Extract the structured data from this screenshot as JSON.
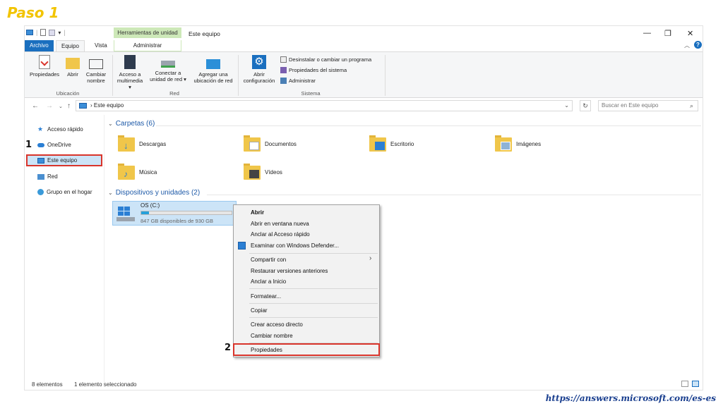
{
  "overlay": {
    "step_title": "Paso 1",
    "marker_1": "1",
    "marker_2": "2",
    "source_url": "https://answers.microsoft.com/es-es"
  },
  "window": {
    "context_tab_group": "Herramientas de unidad",
    "title": "Este equipo",
    "tabs": [
      "Archivo",
      "Equipo",
      "Vista",
      "Administrar"
    ],
    "active_tab": "Equipo",
    "accent_color": "#1a6fbf"
  },
  "ribbon": {
    "groups": [
      {
        "label": "Ubicación",
        "buttons": [
          {
            "label": "Propiedades",
            "icon": "properties-icon"
          },
          {
            "label": "Abrir",
            "icon": "open-folder-icon"
          },
          {
            "label_line1": "Cambiar",
            "label_line2": "nombre",
            "icon": "rename-icon"
          }
        ]
      },
      {
        "label": "Red",
        "buttons": [
          {
            "label_line1": "Acceso a",
            "label_line2": "multimedia ▾",
            "icon": "media-access-icon"
          },
          {
            "label_line1": "Conectar a",
            "label_line2": "unidad de red ▾",
            "icon": "network-drive-icon"
          },
          {
            "label_line1": "Agregar una",
            "label_line2": "ubicación de red",
            "icon": "network-location-icon"
          }
        ]
      },
      {
        "label": "Sistema",
        "buttons": [
          {
            "label_line1": "Abrir",
            "label_line2": "configuración",
            "icon": "settings-gear-icon"
          }
        ],
        "small_commands": [
          "Desinstalar o cambiar un programa",
          "Propiedades del sistema",
          "Administrar"
        ]
      }
    ]
  },
  "address": {
    "path": "Este equipo",
    "search_placeholder": "Buscar en Este equipo"
  },
  "sidebar": {
    "items": [
      {
        "label": "Acceso rápido",
        "icon": "star-icon"
      },
      {
        "label": "OneDrive",
        "icon": "cloud-icon"
      },
      {
        "label": "Este equipo",
        "icon": "computer-icon",
        "selected": true
      },
      {
        "label": "Red",
        "icon": "network-icon"
      },
      {
        "label": "Grupo en el hogar",
        "icon": "homegroup-icon"
      }
    ]
  },
  "content": {
    "folders_header": "Carpetas (6)",
    "folders": [
      {
        "name": "Descargas",
        "icon": "downloads-folder-icon"
      },
      {
        "name": "Documentos",
        "icon": "documents-folder-icon"
      },
      {
        "name": "Escritorio",
        "icon": "desktop-folder-icon"
      },
      {
        "name": "Imágenes",
        "icon": "pictures-folder-icon"
      },
      {
        "name": "Música",
        "icon": "music-folder-icon"
      },
      {
        "name": "Vídeos",
        "icon": "videos-folder-icon"
      }
    ],
    "devices_header": "Dispositivos y unidades (2)",
    "drive": {
      "name": "OS (C:)",
      "free_text": "847 GB disponibles de 930 GB",
      "used_fraction": 0.089
    }
  },
  "context_menu": {
    "items": [
      {
        "label": "Abrir",
        "bold": true
      },
      {
        "label": "Abrir en ventana nueva"
      },
      {
        "label": "Anclar al Acceso rápido"
      },
      {
        "label": "Examinar con Windows Defender...",
        "icon": "defender-icon"
      },
      {
        "separator": true
      },
      {
        "label": "Compartir con",
        "submenu": true
      },
      {
        "label": "Restaurar versiones anteriores"
      },
      {
        "label": "Anclar a Inicio"
      },
      {
        "separator": true
      },
      {
        "label": "Formatear..."
      },
      {
        "separator": true
      },
      {
        "label": "Copiar"
      },
      {
        "separator": true
      },
      {
        "label": "Crear acceso directo"
      },
      {
        "label": "Cambiar nombre"
      },
      {
        "separator": true
      },
      {
        "label": "Propiedades",
        "highlighted": true
      }
    ]
  },
  "status_bar": {
    "item_count": "8 elementos",
    "selection": "1 elemento seleccionado"
  }
}
